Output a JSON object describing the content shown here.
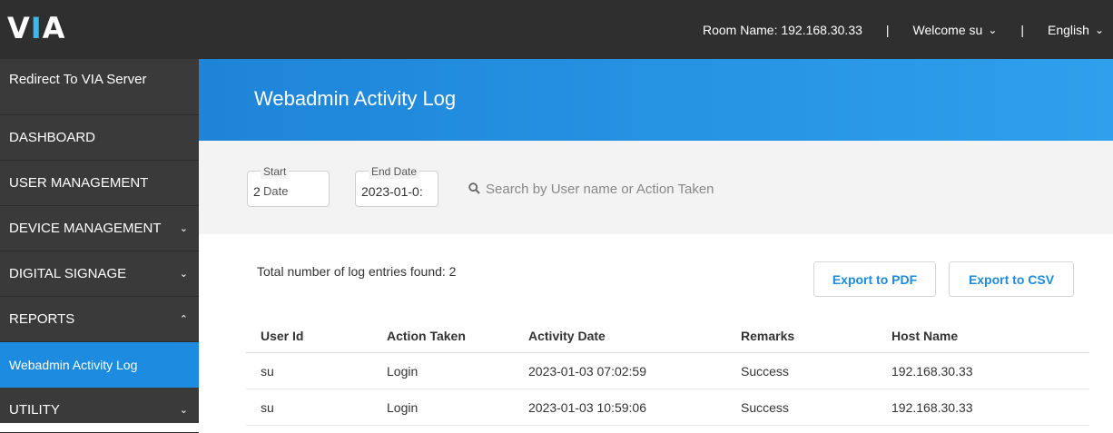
{
  "header": {
    "logo_left": "V",
    "logo_mid": "I",
    "logo_right": "A",
    "room_label": "Room Name: 192.168.30.33",
    "separator": "|",
    "welcome": "Welcome su",
    "language": "English",
    "accent_color": "#3fb8e8"
  },
  "sidebar": {
    "items": [
      {
        "label": "Redirect To VIA Server",
        "arrow": ""
      },
      {
        "label": "DASHBOARD",
        "arrow": ""
      },
      {
        "label": "USER MANAGEMENT",
        "arrow": ""
      },
      {
        "label": "DEVICE MANAGEMENT",
        "arrow": "˅"
      },
      {
        "label": "DIGITAL SIGNAGE",
        "arrow": "˅"
      },
      {
        "label": "REPORTS",
        "arrow": "˄"
      },
      {
        "label": "Webadmin Activity Log",
        "arrow": ""
      },
      {
        "label": "UTILITY",
        "arrow": "˅"
      }
    ],
    "active_color": "#1d8be0"
  },
  "page": {
    "title": "Webadmin Activity Log"
  },
  "filters": {
    "start_legend": "Start",
    "start_legend2": "Date",
    "start_value": "2",
    "end_legend": "End Date",
    "end_value": "2023-01-0:",
    "search_placeholder": "Search by User name or Action Taken"
  },
  "results": {
    "count_text": "Total number of log entries found: 2",
    "export_pdf": "Export to PDF",
    "export_csv": "Export to CSV"
  },
  "table": {
    "headers": [
      "User Id",
      "Action Taken",
      "Activity Date",
      "Remarks",
      "Host Name"
    ],
    "rows": [
      [
        "su",
        "Login",
        "2023-01-03 07:02:59",
        "Success",
        "192.168.30.33"
      ],
      [
        "su",
        "Login",
        "2023-01-03 10:59:06",
        "Success",
        "192.168.30.33"
      ]
    ]
  }
}
